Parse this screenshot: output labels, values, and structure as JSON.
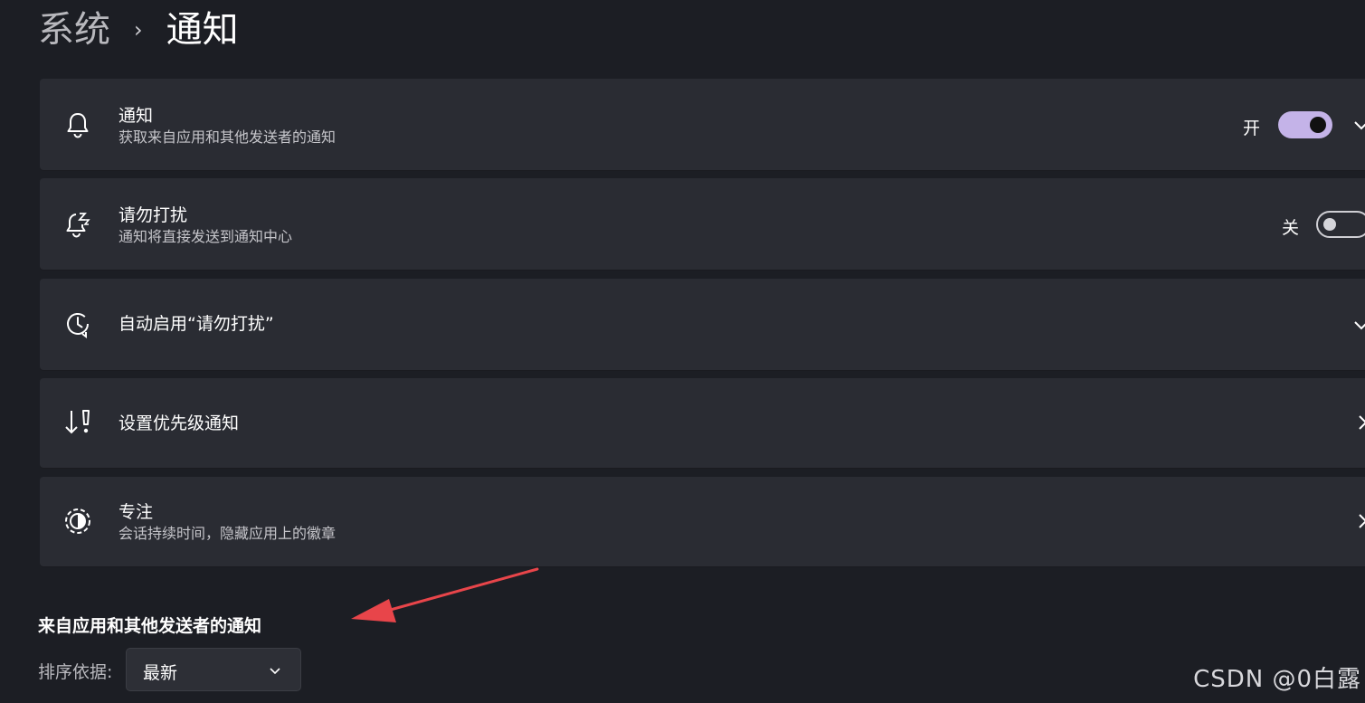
{
  "breadcrumb": {
    "parent": "系统",
    "separator": "›",
    "current": "通知"
  },
  "cards": [
    {
      "icon": "bell-icon",
      "title": "通知",
      "subtitle": "获取来自应用和其他发送者的通知",
      "toggle_label": "开",
      "toggle_state": "on",
      "trailing": "chevron-down"
    },
    {
      "icon": "bell-snooze-icon",
      "title": "请勿打扰",
      "subtitle": "通知将直接发送到通知中心",
      "toggle_label": "关",
      "toggle_state": "off"
    },
    {
      "icon": "clock-refresh-icon",
      "title": "自动启用“请勿打扰”",
      "trailing": "chevron-down"
    },
    {
      "icon": "priority-arrow-icon",
      "title": "设置优先级通知",
      "trailing": "chevron-right"
    },
    {
      "icon": "focus-timer-icon",
      "title": "专注",
      "subtitle": "会话持续时间，隐藏应用上的徽章",
      "trailing": "chevron-right"
    }
  ],
  "section": {
    "heading": "来自应用和其他发送者的通知",
    "sort_label": "排序依据:",
    "sort_value": "最新"
  },
  "watermark": "CSDN @0白露",
  "colors": {
    "background": "#1c1e24",
    "card": "#2a2c33",
    "toggle_on": "#c4b3e8",
    "annotation_arrow": "#e8454a"
  }
}
